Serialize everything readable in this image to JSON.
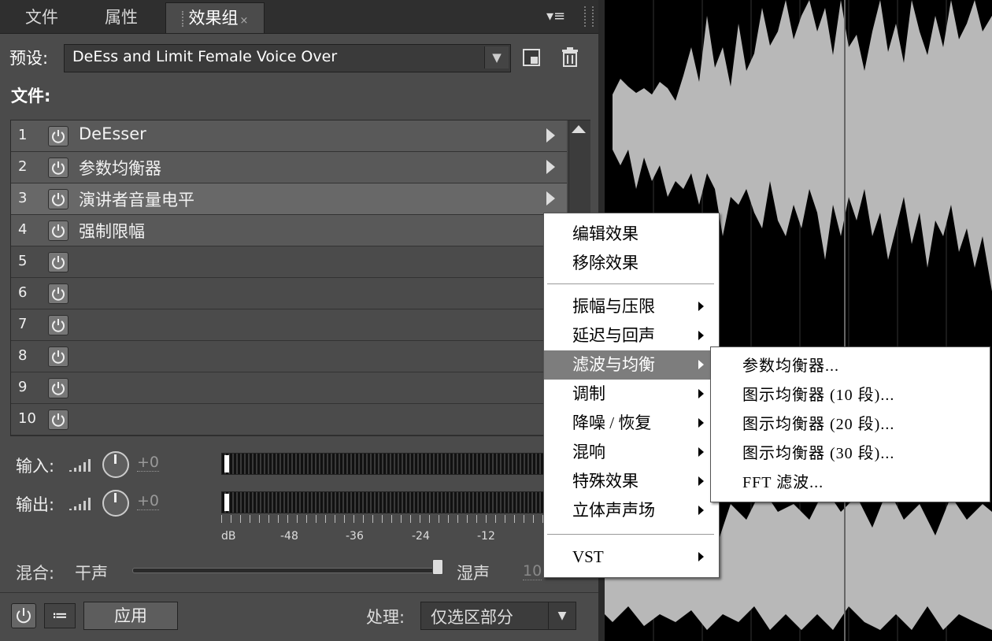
{
  "tabs": [
    {
      "label": "文件",
      "active": false
    },
    {
      "label": "属性",
      "active": false
    },
    {
      "label": "效果组",
      "active": true,
      "close": "×"
    }
  ],
  "panel_menu_icon": "▾≡",
  "preset": {
    "label": "预设:",
    "value": "DeEss and Limit Female Voice Over",
    "arrow": "▼"
  },
  "file_label": "文件:",
  "slots": [
    {
      "num": "1",
      "name": "DeEsser"
    },
    {
      "num": "2",
      "name": "参数均衡器"
    },
    {
      "num": "3",
      "name": "演讲者音量电平"
    },
    {
      "num": "4",
      "name": "强制限幅"
    },
    {
      "num": "5",
      "name": ""
    },
    {
      "num": "6",
      "name": ""
    },
    {
      "num": "7",
      "name": ""
    },
    {
      "num": "8",
      "name": ""
    },
    {
      "num": "9",
      "name": ""
    },
    {
      "num": "10",
      "name": ""
    }
  ],
  "io": {
    "input_label": "输入:",
    "input_value": "+0",
    "output_label": "输出:",
    "output_value": "+0"
  },
  "meter_scale": [
    "dB",
    "-48",
    "-36",
    "-24",
    "-12"
  ],
  "mix": {
    "label": "混合:",
    "dry": "干声",
    "wet": "湿声",
    "value": "10",
    "position": 0.99
  },
  "bottom": {
    "list_icon": "≔",
    "apply": "应用",
    "process_label": "处理:",
    "process_value": "仅选区部分",
    "process_arrow": "▼"
  },
  "effect_menu": {
    "top": [
      "编辑效果",
      "移除效果"
    ],
    "categories": [
      "振幅与压限",
      "延迟与回声",
      "滤波与均衡",
      "调制",
      "降噪 / 恢复",
      "混响",
      "特殊效果",
      "立体声声场"
    ],
    "highlighted": "滤波与均衡",
    "vst": "VST"
  },
  "filter_submenu": [
    "参数均衡器...",
    "图示均衡器 (10 段)...",
    "图示均衡器 (20 段)...",
    "图示均衡器 (30 段)...",
    "FFT 滤波..."
  ],
  "colors": {
    "panel": "#4b4b4b",
    "waveform": "#b8b8b8",
    "highlight": "#7d7d7d"
  },
  "icons": [
    "power-icon",
    "save-preset-icon",
    "trash-icon",
    "panel-menu-icon",
    "level-bars-icon",
    "knob-icon",
    "list-icon"
  ]
}
